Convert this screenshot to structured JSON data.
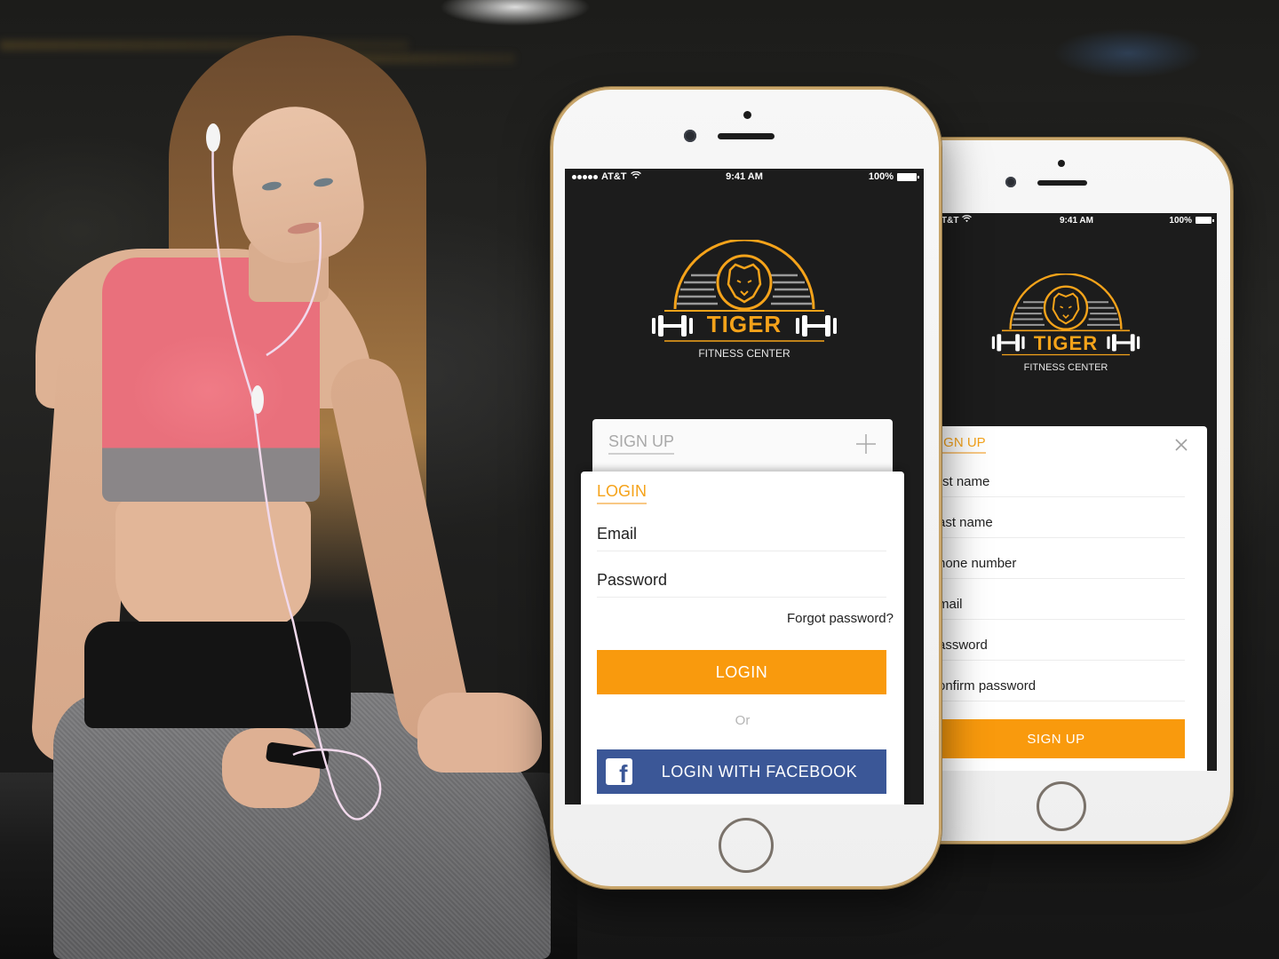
{
  "brand": {
    "name": "TIGER",
    "tagline": "FITNESS CENTER",
    "accent_color": "#f99a0d",
    "facebook_color": "#3b5797"
  },
  "status_bar": {
    "carrier": "AT&T",
    "carrier_truncated": "T&T",
    "time": "9:41 AM",
    "battery": "100%",
    "signal_icon": "signal-dots-icon",
    "wifi_icon": "wifi-icon",
    "battery_icon": "battery-icon"
  },
  "login_phone": {
    "signup_tab": {
      "label": "SIGN UP",
      "expand_icon": "plus-icon"
    },
    "login_card": {
      "title": "LOGIN",
      "fields": [
        {
          "placeholder": "Email"
        },
        {
          "placeholder": "Password"
        }
      ],
      "forgot_password": "Forgot password?",
      "login_button": "LOGIN",
      "divider": "Or",
      "facebook_button": "LOGIN WITH FACEBOOK",
      "facebook_icon": "facebook-icon"
    }
  },
  "signup_phone": {
    "signup_card": {
      "title": "SIGN UP",
      "title_visible": "IGN UP",
      "close_icon": "close-icon",
      "fields": [
        {
          "placeholder": "First name",
          "visible": "rst name"
        },
        {
          "placeholder": "Last name",
          "visible": "ast name"
        },
        {
          "placeholder": "Phone number",
          "visible": "hone number"
        },
        {
          "placeholder": "Email",
          "visible": "mail"
        },
        {
          "placeholder": "Password",
          "visible": "assword"
        },
        {
          "placeholder": "Confirm password",
          "visible": "onfirm password"
        }
      ],
      "signup_button": "SIGN UP"
    }
  }
}
